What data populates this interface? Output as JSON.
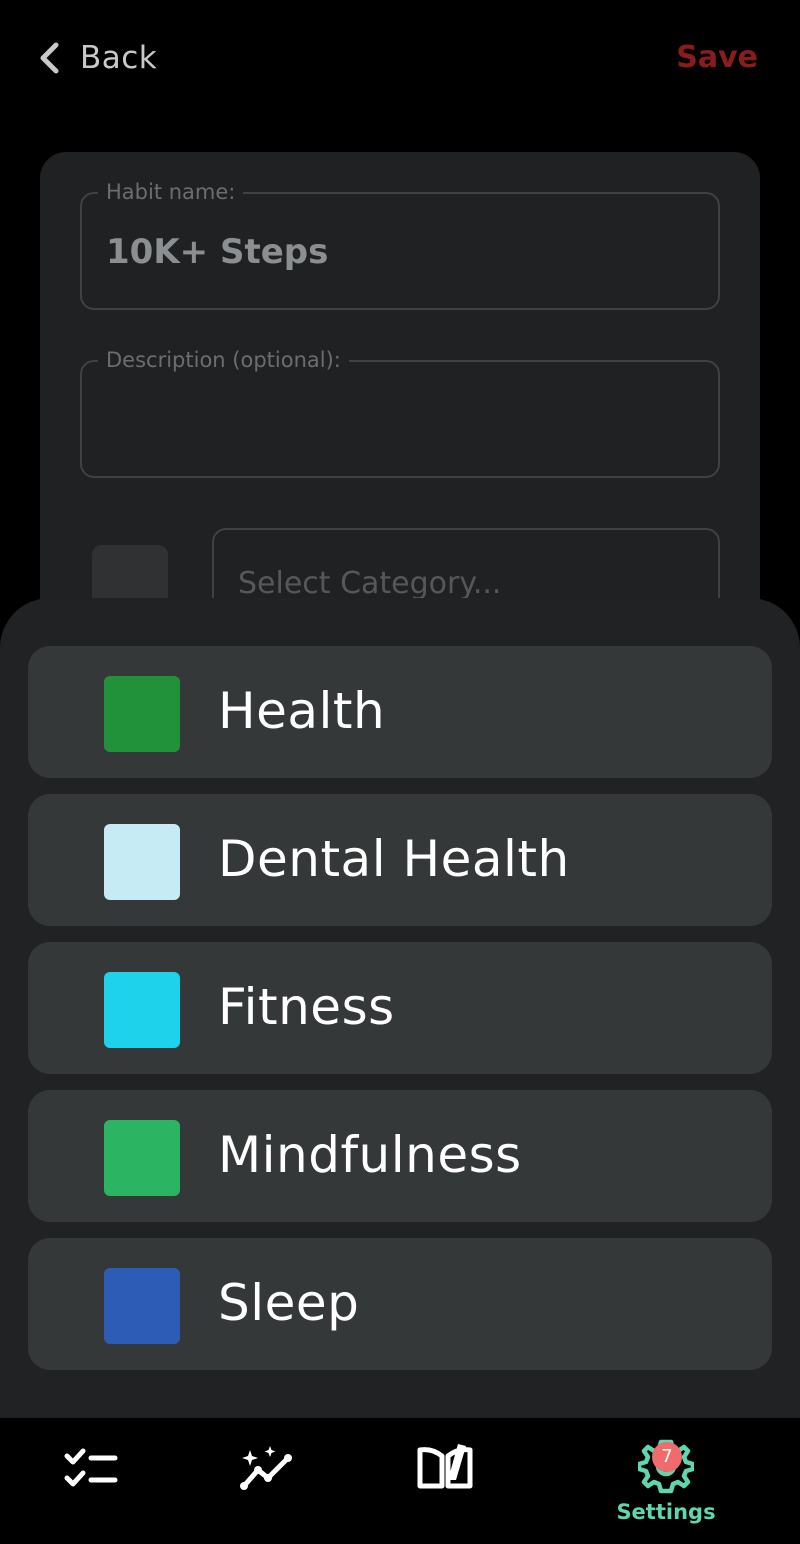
{
  "header": {
    "back_label": "Back",
    "save_label": "Save"
  },
  "form": {
    "habit_name_label": "Habit name:",
    "habit_name_value": "10K+ Steps",
    "description_label": "Description (optional):",
    "description_value": "",
    "category_placeholder": "Select Category..."
  },
  "categories": [
    {
      "name": "Health",
      "color": "#22923a"
    },
    {
      "name": "Dental Health",
      "color": "#c6ebf4"
    },
    {
      "name": "Fitness",
      "color": "#1fd2ec"
    },
    {
      "name": "Mindfulness",
      "color": "#2bb562"
    },
    {
      "name": "Sleep",
      "color": "#2d5cb6"
    }
  ],
  "nav": {
    "items": [
      {
        "icon": "checklist-icon"
      },
      {
        "icon": "sparkle-trend-icon"
      },
      {
        "icon": "book-open-icon"
      },
      {
        "icon": "gear-icon",
        "label": "Settings",
        "badge": "7",
        "active": true
      }
    ]
  },
  "colors": {
    "accent_save": "#8b1c1c",
    "accent_active": "#5fd6b0",
    "badge": "#f06b6b"
  }
}
